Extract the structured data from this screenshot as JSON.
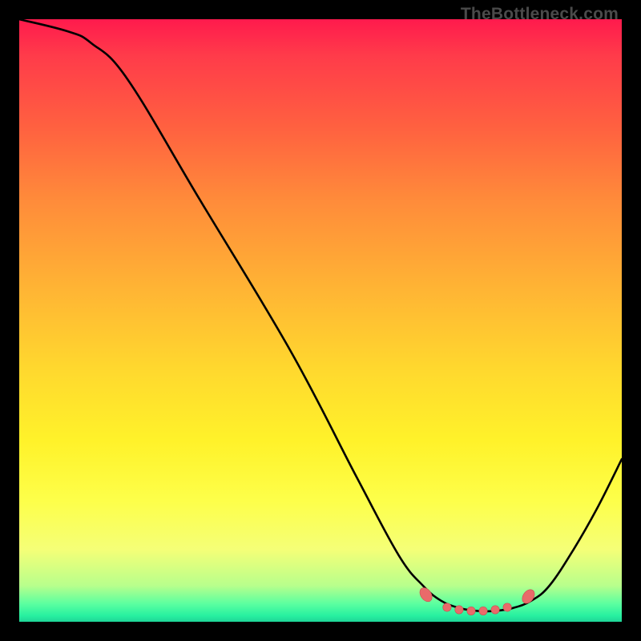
{
  "watermark": "TheBottleneck.com",
  "chart_data": {
    "type": "line",
    "title": "",
    "xlabel": "",
    "ylabel": "",
    "xlim": [
      0,
      100
    ],
    "ylim": [
      0,
      100
    ],
    "series": [
      {
        "name": "curve",
        "points": [
          {
            "x": 0,
            "y": 100
          },
          {
            "x": 8,
            "y": 98
          },
          {
            "x": 12,
            "y": 96
          },
          {
            "x": 18,
            "y": 90
          },
          {
            "x": 30,
            "y": 70
          },
          {
            "x": 45,
            "y": 45
          },
          {
            "x": 56,
            "y": 24
          },
          {
            "x": 63,
            "y": 11
          },
          {
            "x": 67,
            "y": 6
          },
          {
            "x": 70,
            "y": 3.5
          },
          {
            "x": 73,
            "y": 2.3
          },
          {
            "x": 76,
            "y": 1.8
          },
          {
            "x": 79,
            "y": 1.8
          },
          {
            "x": 82,
            "y": 2.3
          },
          {
            "x": 85,
            "y": 3.5
          },
          {
            "x": 88,
            "y": 6
          },
          {
            "x": 92,
            "y": 12
          },
          {
            "x": 96,
            "y": 19
          },
          {
            "x": 100,
            "y": 27
          }
        ]
      }
    ],
    "markers": [
      {
        "x": 67.5,
        "y": 4.5
      },
      {
        "x": 71,
        "y": 2.4
      },
      {
        "x": 73,
        "y": 2.0
      },
      {
        "x": 75,
        "y": 1.8
      },
      {
        "x": 77,
        "y": 1.8
      },
      {
        "x": 79,
        "y": 2.0
      },
      {
        "x": 81,
        "y": 2.4
      },
      {
        "x": 84.5,
        "y": 4.2
      }
    ],
    "colors": {
      "curve": "#000000",
      "marker_fill": "#e96a6a",
      "marker_stroke": "#c94f4f"
    }
  }
}
